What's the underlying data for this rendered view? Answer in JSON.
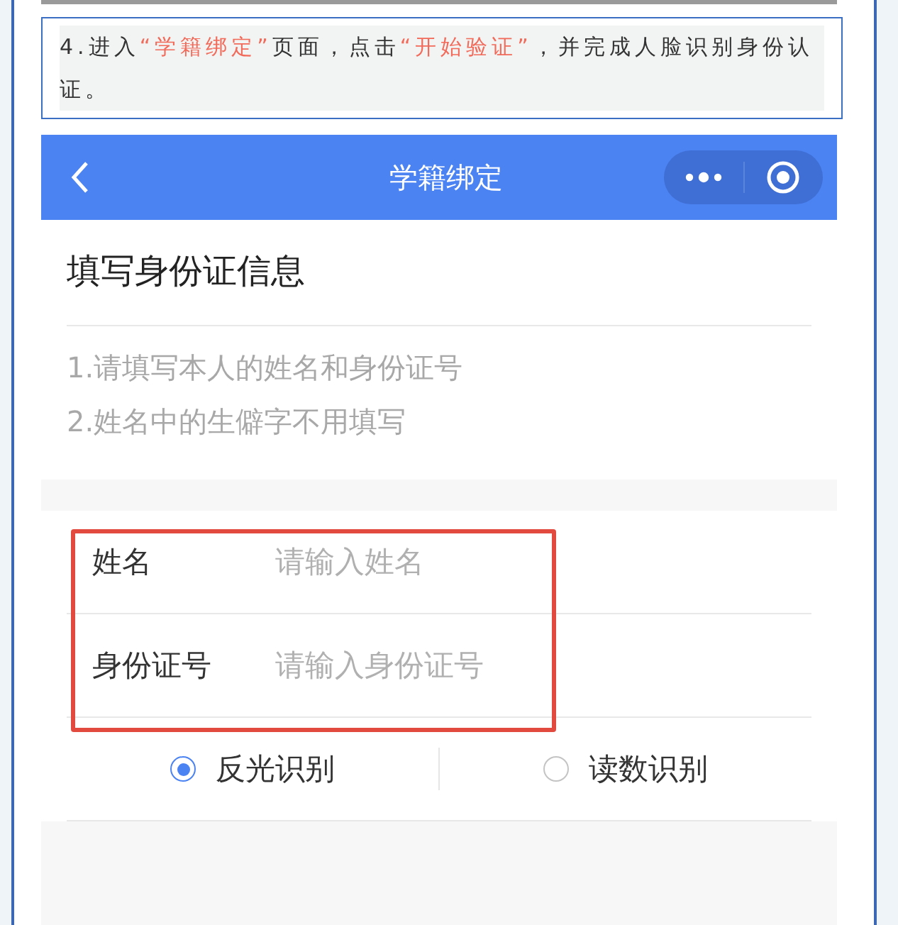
{
  "note": {
    "segments": [
      {
        "text": "4.进入",
        "highlight": false
      },
      {
        "text": "“学籍绑定”",
        "highlight": true
      },
      {
        "text": "页面，点击",
        "highlight": false
      },
      {
        "text": "“开始验证”",
        "highlight": true
      },
      {
        "text": "，并完成人脸识别身份认证。",
        "highlight": false
      }
    ]
  },
  "phone": {
    "header": {
      "title": "学籍绑定"
    },
    "section_title": "填写身份证信息",
    "tips": [
      "1.请填写本人的姓名和身份证号",
      "2.姓名中的生僻字不用填写"
    ],
    "fields": [
      {
        "label": "姓名",
        "placeholder": "请输入姓名"
      },
      {
        "label": "身份证号",
        "placeholder": "请输入身份证号"
      }
    ],
    "highlight_fields": true,
    "options": [
      {
        "label": "反光识别",
        "selected": true
      },
      {
        "label": "读数识别",
        "selected": false
      }
    ]
  }
}
